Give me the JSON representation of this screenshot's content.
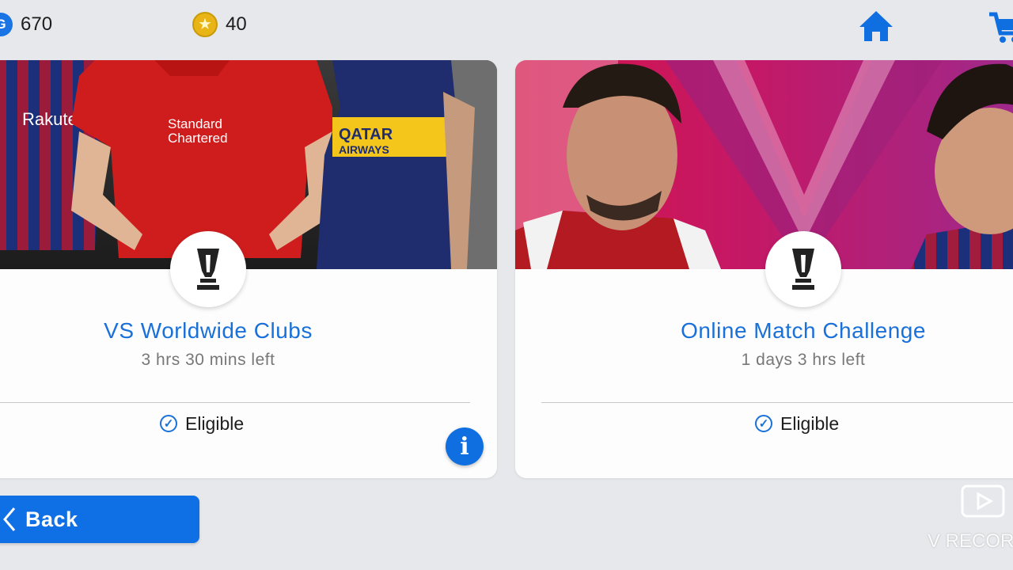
{
  "topbar": {
    "gp": {
      "icon": "gp-coin-icon",
      "value": "670"
    },
    "coins": {
      "icon": "star-coin-icon",
      "value": "40"
    },
    "home_icon": "home-icon",
    "cart_icon": "cart-icon"
  },
  "events": [
    {
      "title": "VS Worldwide Clubs",
      "time_left": "3 hrs 30 mins left",
      "status": "Eligible",
      "banner_text_1": "Rakuten",
      "banner_text_2": "Standard",
      "banner_text_3": "Chartered",
      "banner_text_4": "QATAR",
      "banner_text_5": "AIRWAYS"
    },
    {
      "title": "Online Match Challenge",
      "time_left": "1 days 3 hrs left",
      "status": "Eligible"
    }
  ],
  "info_button": {
    "label": "i"
  },
  "back_button": {
    "label": "Back"
  },
  "watermark": {
    "text": "V RECOR"
  },
  "colors": {
    "accent": "#1a70d9",
    "button": "#0f70e6",
    "background": "#e7e8ec"
  }
}
